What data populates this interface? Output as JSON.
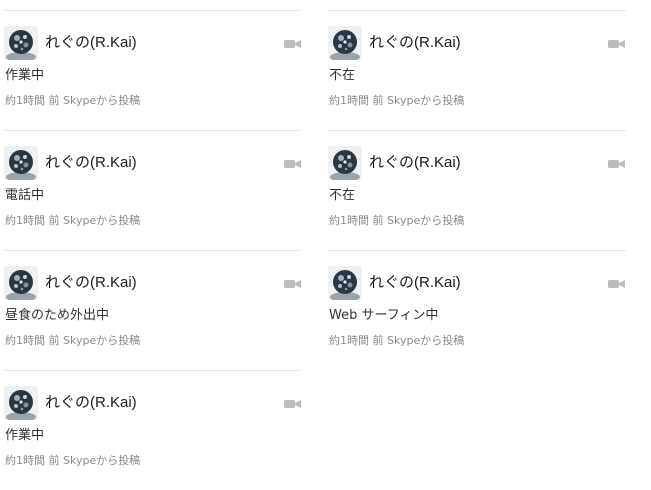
{
  "feed": {
    "left_column": [
      {
        "author": "れぐの(R.Kai)",
        "status": "作業中",
        "time": "約1時間 前",
        "source": "Skypeから投稿",
        "avatar_icon": "user-avatar-icon",
        "media_icon": "video-camera-icon"
      },
      {
        "author": "れぐの(R.Kai)",
        "status": "電話中",
        "time": "約1時間 前",
        "source": "Skypeから投稿",
        "avatar_icon": "user-avatar-icon",
        "media_icon": "video-camera-icon"
      },
      {
        "author": "れぐの(R.Kai)",
        "status": "昼食のため外出中",
        "time": "約1時間 前",
        "source": "Skypeから投稿",
        "avatar_icon": "user-avatar-icon",
        "media_icon": "video-camera-icon"
      },
      {
        "author": "れぐの(R.Kai)",
        "status": "作業中",
        "time": "約1時間 前",
        "source": "Skypeから投稿",
        "avatar_icon": "user-avatar-icon",
        "media_icon": "video-camera-icon"
      }
    ],
    "right_column": [
      {
        "author": "れぐの(R.Kai)",
        "status": "不在",
        "time": "約1時間 前",
        "source": "Skypeから投稿",
        "avatar_icon": "user-avatar-icon",
        "media_icon": "video-camera-icon"
      },
      {
        "author": "れぐの(R.Kai)",
        "status": "不在",
        "time": "約1時間 前",
        "source": "Skypeから投稿",
        "avatar_icon": "user-avatar-icon",
        "media_icon": "video-camera-icon"
      },
      {
        "author": "れぐの(R.Kai)",
        "status": "Web サーフィン中",
        "time": "約1時間 前",
        "source": "Skypeから投稿",
        "avatar_icon": "user-avatar-icon",
        "media_icon": "video-camera-icon"
      }
    ]
  },
  "colors": {
    "divider": "#e6e6e6",
    "meta_text": "#8a8a8a",
    "camera_icon": "#bdbdbd"
  }
}
